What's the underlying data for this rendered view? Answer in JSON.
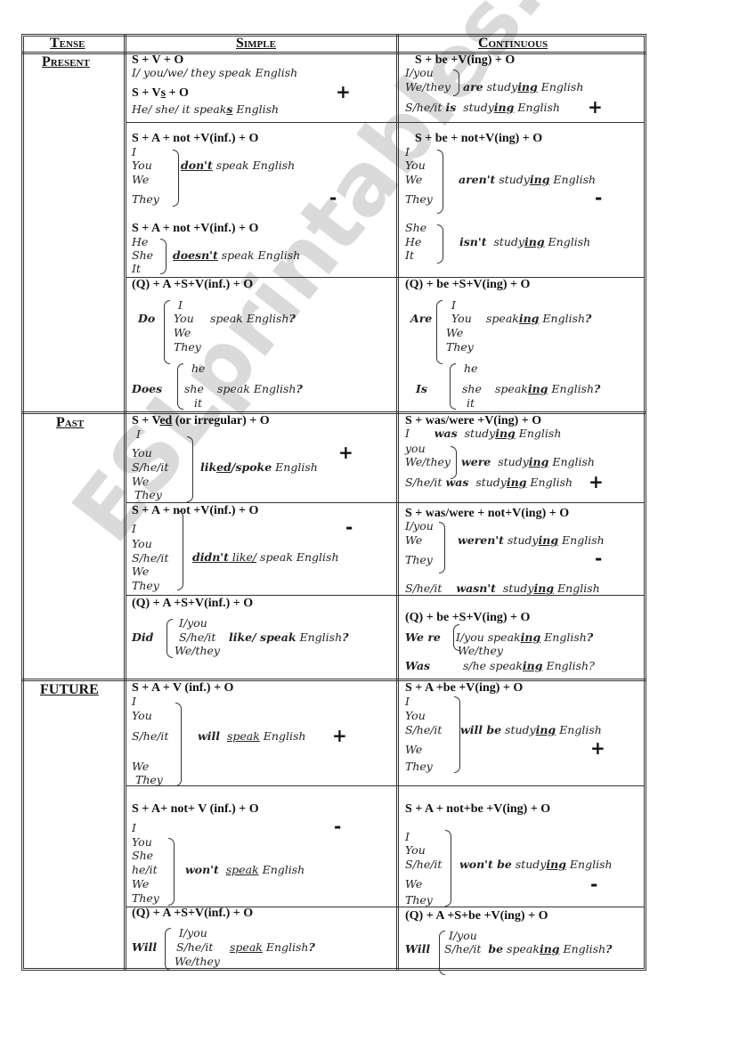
{
  "headers": {
    "tense": "Tense",
    "simple": "Simple",
    "continuous": "Continuous"
  },
  "tenses": {
    "present": "Present",
    "past": "Past",
    "future": "FUTURE"
  },
  "watermark": "ESLprintables.com",
  "signs": {
    "plus": "+",
    "minus": "-"
  },
  "present": {
    "simple_aff": {
      "formula1": "S + V + O",
      "example1": "I/ you/we/ they speak English",
      "formula2_pre": "S + V",
      "formula2_s": "s",
      "formula2_post": " + O",
      "example2_pre": "He/ she/ it speak",
      "example2_s": "s",
      "example2_post": " English"
    },
    "cont_aff": {
      "formula": "S +   be +V(ing) + O",
      "subj1": "I/you",
      "subj2": "We/they",
      "aux1": "are",
      "subj3": "S/he/it",
      "aux2": "is",
      "verb_pre": "study",
      "verb_ing": "ing",
      "object": " English"
    },
    "simple_neg": {
      "formula1": "S + A + not +V(inf.) + O",
      "subjects1": [
        "I",
        "You",
        "We",
        "They"
      ],
      "aux1": "don't",
      "rest": " speak English",
      "formula2": "S + A + not +V(inf.) + O",
      "subjects2": [
        "He",
        "She",
        "It"
      ],
      "aux2": "doesn't"
    },
    "cont_neg": {
      "formula": "S +   be + not+V(ing) + O",
      "subjects1": [
        "I",
        "You",
        "We",
        "They"
      ],
      "aux1": "aren't",
      "subjects2": [
        "She",
        "He",
        "It"
      ],
      "aux2": "isn't",
      "verb_pre": "study",
      "verb_ing": "ing",
      "object": " English"
    },
    "simple_q": {
      "formula": "(Q) + A +S+V(inf.) + O",
      "aux1": "Do",
      "subjects1": [
        "I",
        "You",
        "We",
        "They"
      ],
      "aux2": "Does",
      "subjects2": [
        "he",
        "she",
        "it"
      ],
      "rest": "speak English",
      "qmark": "?"
    },
    "cont_q": {
      "formula": "(Q) + be +S+V(ing) + O",
      "aux1": "Are",
      "subjects1": [
        "I",
        "You",
        "We",
        "They"
      ],
      "aux2": "Is",
      "subjects2": [
        "he",
        "she",
        "it"
      ],
      "verb_pre": "speak",
      "verb_ing": "ing",
      "object": " English",
      "qmark": "?"
    }
  },
  "past": {
    "simple_aff": {
      "formula_pre": "S + V",
      "formula_ed": "ed",
      "formula_post": " (or irregular) + O",
      "subjects": [
        "I",
        "You",
        "S/he/it",
        "We",
        "They"
      ],
      "verb_pre": "lik",
      "verb_ed": "ed",
      "verb_post": "/spoke",
      "object": " English"
    },
    "cont_aff": {
      "formula": "S +   was/were +V(ing) + O",
      "subj1": "I",
      "aux1": "was",
      "subj2": "you",
      "subj3": "We/they",
      "aux2": "were",
      "subj4": "S/he/it",
      "aux3": "was",
      "verb_pre": "study",
      "verb_ing": "ing",
      "object": " English"
    },
    "simple_neg": {
      "formula": " S + A + not +V(inf.) + O",
      "subjects": [
        "I",
        "You",
        "S/he/it",
        "We",
        "They"
      ],
      "aux": "didn't",
      "verb": " like/",
      "rest": " speak English"
    },
    "cont_neg": {
      "formula": "S + was/were + not+V(ing) + O",
      "subjects": [
        "I/you",
        "We",
        "They"
      ],
      "aux1": "weren't",
      "subj2": "S/he/it",
      "aux2": "wasn't",
      "verb_pre": "study",
      "verb_ing": "ing",
      "object": " English"
    },
    "simple_q": {
      "formula": "(Q) + A +S+V(inf.) + O",
      "aux": "Did",
      "subjects": [
        "I/you",
        "S/he/it",
        "We/they"
      ],
      "verb": "like/ speak",
      "rest": " English",
      "qmark": "?"
    },
    "cont_q": {
      "formula": "(Q) + be +S+V(ing) + O",
      "aux1": "We re",
      "subjects1": [
        "I/you",
        "We/they"
      ],
      "aux2": "Was",
      "subj2": "s/he",
      "verb_pre": " speak",
      "verb_ing": "ing",
      "object": " English",
      "qmark": "?"
    }
  },
  "future": {
    "simple_aff": {
      "formula": "S + A + V (inf.) + O",
      "subjects": [
        "I",
        "You",
        "S/he/it",
        "We",
        "They"
      ],
      "aux": "will",
      "verb": "speak",
      "object": " English"
    },
    "cont_aff": {
      "formula": "S +   A +be +V(ing) + O",
      "subjects": [
        "I",
        "You",
        "S/he/it",
        "We",
        "They"
      ],
      "aux": "will be",
      "verb_pre": " study",
      "verb_ing": "ing",
      "object": " English"
    },
    "simple_neg": {
      "formula": "S + A+ not+ V (inf.) + O",
      "subjects": [
        "I",
        "You",
        "She",
        "he/it",
        "We",
        "They"
      ],
      "aux": "won't",
      "verb": "speak",
      "object": " English"
    },
    "cont_neg": {
      "formula": "S + A + not+be +V(ing) + O",
      "subjects": [
        "I",
        "You",
        "S/he/it",
        "We",
        "They"
      ],
      "aux": "won't be",
      "verb_pre": " study",
      "verb_ing": "ing",
      "object": " English"
    },
    "simple_q": {
      "formula": "(Q) + A +S+V(inf.) + O",
      "aux": "Will",
      "subjects": [
        "I/you",
        "S/he/it",
        "We/they"
      ],
      "verb": "speak",
      "object": " English",
      "qmark": "?"
    },
    "cont_q": {
      "formula": "(Q) + A +S+be +V(ing) + O",
      "aux": "Will",
      "subjects": [
        "I/you",
        "S/he/it"
      ],
      "be": "be",
      "verb_pre": " speak",
      "verb_ing": "ing",
      "object": " English",
      "qmark": "?"
    }
  }
}
